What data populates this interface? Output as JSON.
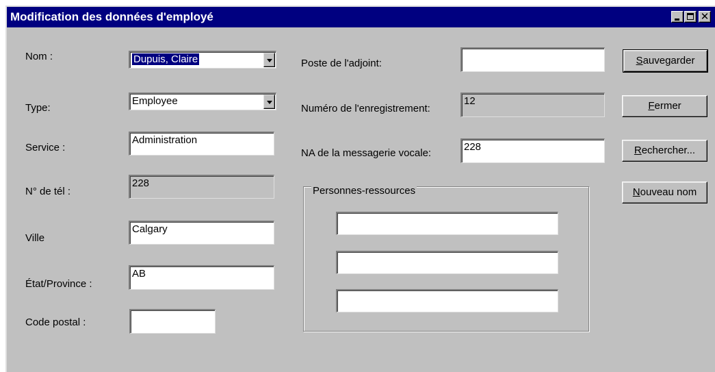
{
  "window": {
    "title": "Modification des données d'employé",
    "controls": {
      "minimize_icon": "minimize-icon",
      "maximize_icon": "maximize-icon",
      "close_glyph": "✕"
    }
  },
  "form_left": {
    "nom": {
      "label": "Nom :",
      "value": "Dupuis, Claire"
    },
    "type": {
      "label": "Type:",
      "value": "Employee"
    },
    "service": {
      "label": "Service :",
      "value": "Administration"
    },
    "tel": {
      "label": "N° de tél :",
      "value": "228"
    },
    "ville": {
      "label": "Ville",
      "value": "Calgary"
    },
    "etat": {
      "label": "État/Province :",
      "value": "AB"
    },
    "code_postal": {
      "label": "Code postal :",
      "value": ""
    }
  },
  "form_middle": {
    "poste_adjoint": {
      "label": "Poste de l'adjoint:",
      "value": ""
    },
    "numero_enreg": {
      "label": "Numéro de l'enregistrement:",
      "value": "12"
    },
    "na_messagerie": {
      "label": "NA de la messagerie vocale:",
      "value": "228"
    },
    "personnes": {
      "legend": "Personnes-ressources",
      "values": [
        "",
        "",
        ""
      ]
    }
  },
  "buttons": {
    "sauvegarder": {
      "mnemonic": "S",
      "rest": "auvegarder"
    },
    "fermer": {
      "mnemonic": "F",
      "rest": "ermer"
    },
    "rechercher": {
      "mnemonic": "R",
      "rest": "echercher..."
    },
    "nouveau": {
      "mnemonic": "N",
      "rest": "ouveau nom"
    }
  }
}
